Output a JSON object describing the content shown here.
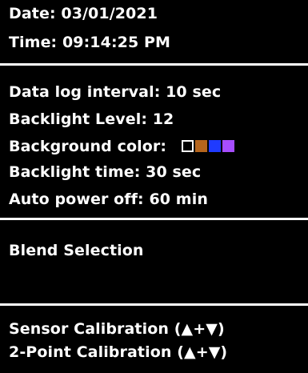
{
  "header": {
    "date": "Date: 03/01/2021",
    "time": "Time: 09:14:25 PM"
  },
  "settings": {
    "data_log_interval": "Data log interval: 10 sec",
    "backlight_level": "Backlight Level: 12",
    "background_color_label": "Background color:",
    "background_color_swatches": [
      "#000000",
      "#b5651d",
      "#1f3bff",
      "#a64dff"
    ],
    "backlight_time": "Backlight time: 30 sec",
    "auto_power_off": "Auto power off: 60 min"
  },
  "blend": {
    "label": "Blend Selection"
  },
  "calibration": {
    "sensor": "Sensor Calibration (▲+▼)",
    "two_point": "2-Point Calibration (▲+▼)"
  }
}
